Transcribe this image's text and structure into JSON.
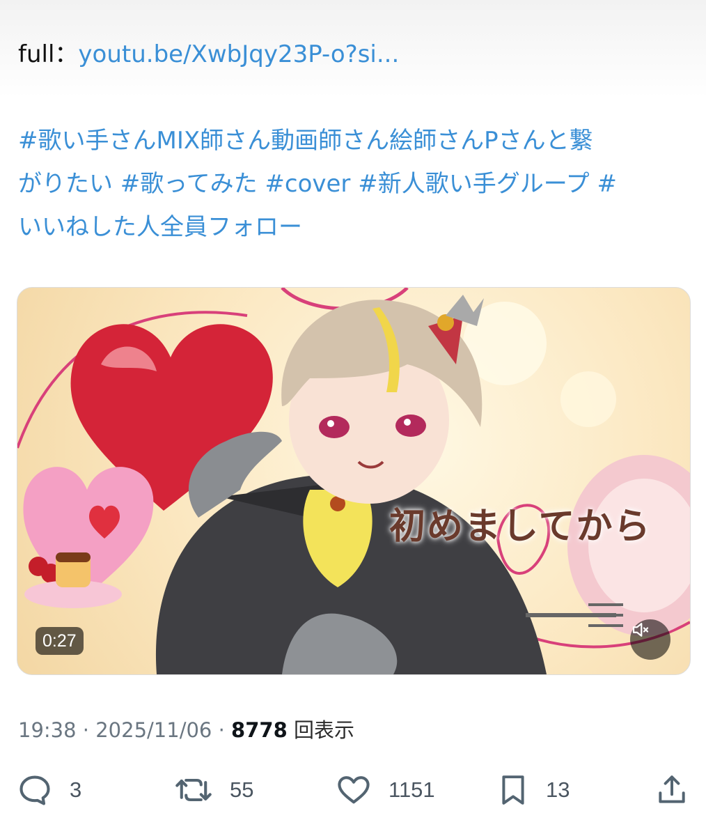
{
  "tweet": {
    "full_prefix": "full：",
    "link_text": "youtu.be/XwbJqy23P-o?si...",
    "hashtags_line1": "#歌い手さんMIX師さん動画師さん絵師さんPさんと繋",
    "hashtags_line2": "がりたい #歌ってみた #cover #新人歌い手グループ #",
    "hashtags_line3": "いいねした人全員フォロー"
  },
  "media": {
    "duration": "0:27",
    "overlay_text": "初めましてから"
  },
  "meta": {
    "time": "19:38",
    "sep1": " · ",
    "date": "2025/11/06",
    "sep2": " · ",
    "views": "8778",
    "views_label": " 回表示"
  },
  "actions": {
    "replies": "3",
    "retweets": "55",
    "likes": "1151",
    "bookmarks": "13"
  },
  "colors": {
    "link": "#3a8fd6",
    "icon": "#536471"
  }
}
